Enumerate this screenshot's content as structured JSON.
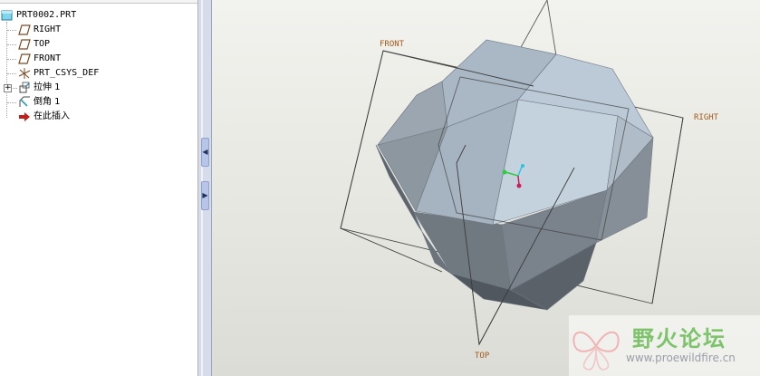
{
  "model_tree": {
    "items": [
      {
        "label": "PRT0002.PRT",
        "icon": "part-icon"
      },
      {
        "label": "RIGHT",
        "icon": "datum-plane-icon"
      },
      {
        "label": "TOP",
        "icon": "datum-plane-icon"
      },
      {
        "label": "FRONT",
        "icon": "datum-plane-icon"
      },
      {
        "label": "PRT_CSYS_DEF",
        "icon": "coordinate-system-icon"
      },
      {
        "label": "拉伸 1",
        "icon": "extrude-icon",
        "expandable": true
      },
      {
        "label": "倒角 1",
        "icon": "chamfer-icon"
      },
      {
        "label": "在此插入",
        "icon": "insert-here-arrow-icon"
      }
    ]
  },
  "viewport": {
    "datum_labels": {
      "front": "FRONT",
      "right": "RIGHT",
      "top": "TOP"
    }
  },
  "watermark": {
    "title": "野火论坛",
    "url": "www.proewildfire.cn"
  },
  "colors": {
    "datum_label": "#a05a1e",
    "model_light": "#b8c6d4",
    "model_dark": "#5d646c",
    "watermark_green": "#7cc36a"
  }
}
